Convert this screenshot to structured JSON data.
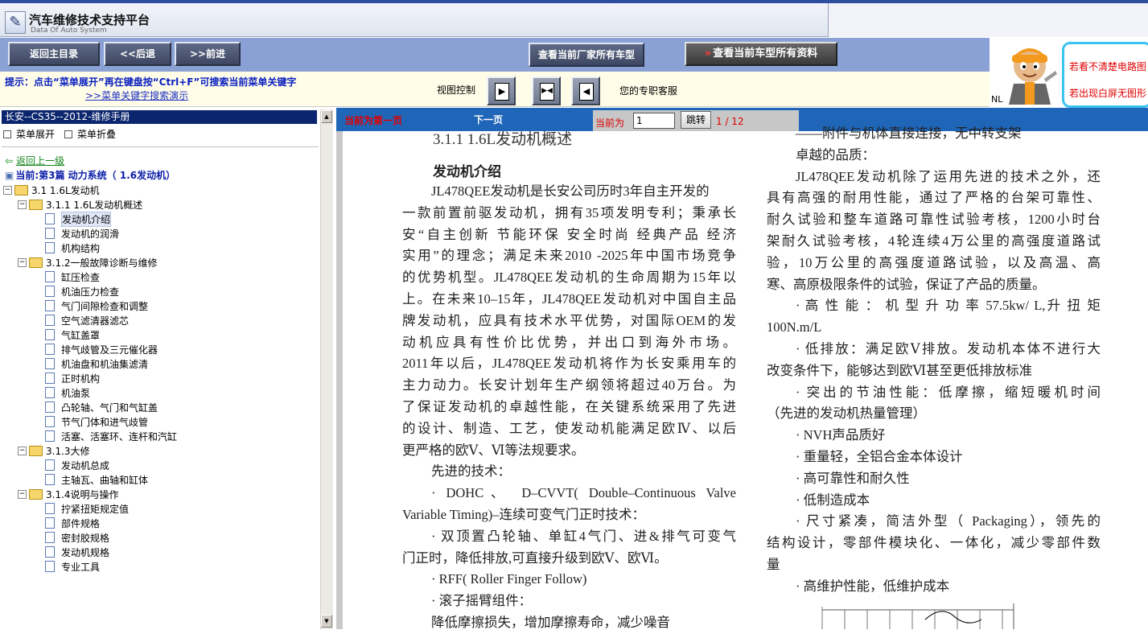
{
  "app": {
    "title": "汽车维修技术支持平台",
    "subtitle": "Data Of Auto System",
    "logo_icon": "wrench-icon"
  },
  "nav": {
    "home": "返回主目录",
    "back": "<<后退",
    "forward": ">>前进",
    "maker_models": "查看当前厂家所有车型",
    "all_data_arrow": "»",
    "all_data": "查看当前车型所有资料"
  },
  "tip": {
    "text": "提示：点击“菜单展开”再在键盘按“Ctrl+F”可搜索当前菜单关键字",
    "link": ">>菜单关键字搜索演示",
    "view_control": "视图控制",
    "service": "您的专职客服"
  },
  "ad": {
    "nl": "NL",
    "line1": "若看不清楚电路图",
    "line2": "若出现白屏无图形"
  },
  "left": {
    "manual_title": "长安--CS35--2012-维修手册",
    "expand": "菜单展开",
    "collapse": "菜单折叠",
    "up_level": "返回上一级",
    "current": "当前:第3篇  动力系统（ 1.6发动机）",
    "tree": [
      {
        "label": "3.1 1.6L发动机",
        "level": 0,
        "type": "folder"
      },
      {
        "label": "3.1.1 1.6L发动机概述",
        "level": 1,
        "type": "folder"
      },
      {
        "label": "发动机介绍",
        "level": 2,
        "type": "doc",
        "selected": true
      },
      {
        "label": "发动机的润滑",
        "level": 2,
        "type": "doc"
      },
      {
        "label": "机构结构",
        "level": 2,
        "type": "doc"
      },
      {
        "label": "3.1.2一般故障诊断与维修",
        "level": 1,
        "type": "folder"
      },
      {
        "label": "缸压检查",
        "level": 2,
        "type": "doc"
      },
      {
        "label": "机油压力检查",
        "level": 2,
        "type": "doc"
      },
      {
        "label": "气门间隙检查和调整",
        "level": 2,
        "type": "doc"
      },
      {
        "label": "空气滤清器滤芯",
        "level": 2,
        "type": "doc"
      },
      {
        "label": "气缸盖罩",
        "level": 2,
        "type": "doc"
      },
      {
        "label": "排气歧管及三元催化器",
        "level": 2,
        "type": "doc"
      },
      {
        "label": "机油盘和机油集滤清",
        "level": 2,
        "type": "doc"
      },
      {
        "label": "正时机构",
        "level": 2,
        "type": "doc"
      },
      {
        "label": "机油泵",
        "level": 2,
        "type": "doc"
      },
      {
        "label": "凸轮轴、气门和气缸盖",
        "level": 2,
        "type": "doc"
      },
      {
        "label": "节气门体和进气歧管",
        "level": 2,
        "type": "doc"
      },
      {
        "label": "活塞、活塞环、连杆和汽缸",
        "level": 2,
        "type": "doc"
      },
      {
        "label": "3.1.3大修",
        "level": 1,
        "type": "folder"
      },
      {
        "label": "发动机总成",
        "level": 2,
        "type": "doc"
      },
      {
        "label": "主轴瓦、曲轴和缸体",
        "level": 2,
        "type": "doc"
      },
      {
        "label": "3.1.4说明与操作",
        "level": 1,
        "type": "folder"
      },
      {
        "label": "拧紧扭矩规定值",
        "level": 2,
        "type": "doc"
      },
      {
        "label": "部件规格",
        "level": 2,
        "type": "doc"
      },
      {
        "label": "密封胶规格",
        "level": 2,
        "type": "doc"
      },
      {
        "label": "发动机规格",
        "level": 2,
        "type": "doc"
      },
      {
        "label": "专业工具",
        "level": 2,
        "type": "doc"
      }
    ]
  },
  "pager": {
    "first": "当前为第一页",
    "next": "下一页",
    "current_label": "当前为",
    "current_value": "1",
    "jump": "跳转",
    "total": "1 / 12"
  },
  "doc": {
    "heading": "3.1.1 1.6L发动机概述",
    "subhead": "发动机介绍",
    "left_lines": [
      {
        "t": "JL478QEE发动机是长安公司历时3年自主开发的",
        "i": true,
        "j": false
      },
      {
        "t": "一款前置前驱发动机，拥有35项发明专利；秉承长",
        "i": false,
        "j": true
      },
      {
        "t": "安“自主创新 节能环保 安全时尚 经典产品 经济",
        "i": false,
        "j": true
      },
      {
        "t": "实用”的理念；满足未来2010 -2025年中国市场竞争",
        "i": false,
        "j": true
      },
      {
        "t": "的优势机型。JL478QEE发动机的生命周期为15年以",
        "i": false,
        "j": true
      },
      {
        "t": "上。在未来10–15年，JL478QEE发动机对中国自主品",
        "i": false,
        "j": true
      },
      {
        "t": "牌发动机，应具有技术水平优势，对国际OEM的发",
        "i": false,
        "j": true
      },
      {
        "t": "动机应具有性价比优势，并出口到海外市场。",
        "i": false,
        "j": true
      },
      {
        "t": "2011年以后，JL478QEE发动机将作为长安乘用车的",
        "i": false,
        "j": true
      },
      {
        "t": "主力动力。长安计划年生产纲领将超过40万台。为",
        "i": false,
        "j": true
      },
      {
        "t": "了保证发动机的卓越性能，在关键系统采用了先进",
        "i": false,
        "j": true
      },
      {
        "t": "的设计、制造、工艺，使发动机能满足欧Ⅳ、以后",
        "i": false,
        "j": true
      },
      {
        "t": "更严格的欧Ⅴ、Ⅵ等法规要求。",
        "i": false,
        "j": false
      },
      {
        "t": "先进的技术：",
        "i": true,
        "j": false
      },
      {
        "t": "· DOHC、 D–CVVT( Double–Continuous Valve",
        "i": true,
        "j": true
      },
      {
        "t": "Variable Timing)–连续可变气门正时技术：",
        "i": false,
        "j": false
      },
      {
        "t": "· 双顶置凸轮轴、单缸4气门、进&排气可变气",
        "i": true,
        "j": true
      },
      {
        "t": "门正时，降低排放,可直接升级到欧Ⅴ、欧Ⅵ。",
        "i": false,
        "j": false
      },
      {
        "t": "· RFF( Roller Finger Follow)",
        "i": true,
        "j": false
      },
      {
        "t": "· 滚子摇臂组件：",
        "i": true,
        "j": false
      },
      {
        "t": "降低摩擦损失，增加摩擦寿命，减少噪音",
        "i": true,
        "j": false
      }
    ],
    "right_lines": [
      {
        "t": "——附件与机体直接连接，无中转支架",
        "i": true,
        "j": false
      },
      {
        "t": "卓越的品质：",
        "i": true,
        "j": false
      },
      {
        "t": "JL478QEE发动机除了运用先进的技术之外，还",
        "i": true,
        "j": true
      },
      {
        "t": "具有高强的耐用性能，通过了严格的台架可靠性、",
        "i": false,
        "j": true
      },
      {
        "t": "耐久试验和整车道路可靠性试验考核，1200小时台",
        "i": false,
        "j": true
      },
      {
        "t": "架耐久试验考核，4轮连续4万公里的高强度道路试",
        "i": false,
        "j": true
      },
      {
        "t": "验，10万公里的高强度道路试验，以及高温、高",
        "i": false,
        "j": true
      },
      {
        "t": "寒、高原极限条件的试验，保证了产品的质量。",
        "i": false,
        "j": false
      },
      {
        "t": "· 高 性 能 ： 机 型 升 功 率 57.5kw/ L,升 扭 矩",
        "i": true,
        "j": true
      },
      {
        "t": "100N.m/L",
        "i": false,
        "j": false
      },
      {
        "t": "· 低排放：满足欧Ⅴ排放。发动机本体不进行大",
        "i": true,
        "j": true
      },
      {
        "t": "改变条件下，能够达到欧Ⅵ甚至更低排放标准",
        "i": false,
        "j": false
      },
      {
        "t": "· 突出的节油性能：低摩擦，缩短暖机时间",
        "i": true,
        "j": true
      },
      {
        "t": "（先进的发动机热量管理）",
        "i": false,
        "j": false
      },
      {
        "t": "· NVH声品质好",
        "i": true,
        "j": false
      },
      {
        "t": "· 重量轻，全铝合金本体设计",
        "i": true,
        "j": false
      },
      {
        "t": "· 高可靠性和耐久性",
        "i": true,
        "j": false
      },
      {
        "t": "· 低制造成本",
        "i": true,
        "j": false
      },
      {
        "t": "· 尺寸紧凑，简洁外型（ Packaging），领先的",
        "i": true,
        "j": true
      },
      {
        "t": "结构设计，零部件模块化、一体化，减少零部件数",
        "i": false,
        "j": true
      },
      {
        "t": "量",
        "i": false,
        "j": false
      },
      {
        "t": "· 高维护性能，低维护成本",
        "i": true,
        "j": false
      }
    ]
  },
  "colors": {
    "nav_bg": "#8aa1d6",
    "doc_bar": "#1f65b8",
    "manual_title_bg": "#0b266e",
    "alert_red": "#e00000",
    "tip_blue": "#0a1fbf"
  }
}
